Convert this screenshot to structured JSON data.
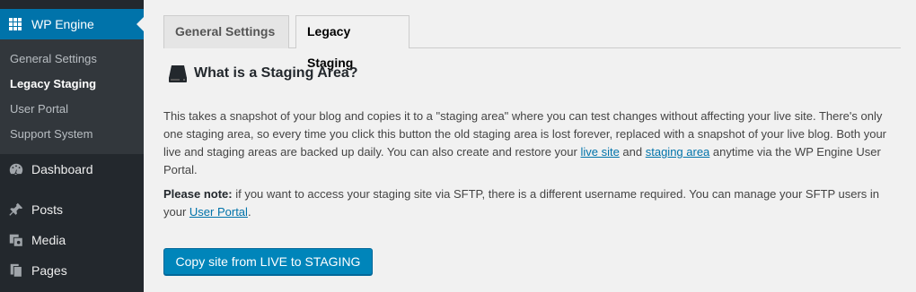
{
  "sidebar": {
    "plugin": {
      "label": "WP Engine",
      "icon": "wpengine-grid-icon"
    },
    "submenu": [
      {
        "label": "General Settings",
        "current": false
      },
      {
        "label": "Legacy Staging",
        "current": true
      },
      {
        "label": "User Portal",
        "current": false
      },
      {
        "label": "Support System",
        "current": false
      }
    ],
    "menu": [
      {
        "label": "Dashboard",
        "icon": "dashboard-icon"
      },
      {
        "label": "Posts",
        "icon": "pushpin-icon"
      },
      {
        "label": "Media",
        "icon": "media-icon"
      },
      {
        "label": "Pages",
        "icon": "pages-icon"
      }
    ]
  },
  "tabs": [
    {
      "label": "General Settings",
      "active": false
    },
    {
      "label": "Legacy Staging",
      "active": true
    }
  ],
  "main": {
    "heading": "What is a Staging Area?",
    "para1": {
      "text_before": "This takes a snapshot of your blog and copies it to a \"staging area\" where you can test changes without affecting your live site. There's only one staging area, so every time you click this button the old staging area is lost forever, replaced with a snapshot of your live blog. Both your live and staging areas are backed up daily. You can also create and restore your ",
      "link1": "live site",
      "text_middle": " and ",
      "link2": "staging area",
      "text_after": " anytime via the WP Engine User Portal."
    },
    "para2": {
      "bold": "Please note:",
      "text_before": " if you want to access your staging site via SFTP, there is a different username required. You can manage your SFTP users in your ",
      "link": "User Portal",
      "text_after": "."
    },
    "button": "Copy site from LIVE to STAGING"
  },
  "colors": {
    "sidebar_bg": "#23282d",
    "submenu_bg": "#32373c",
    "accent": "#0073aa",
    "button": "#0085ba",
    "link": "#0073aa"
  }
}
